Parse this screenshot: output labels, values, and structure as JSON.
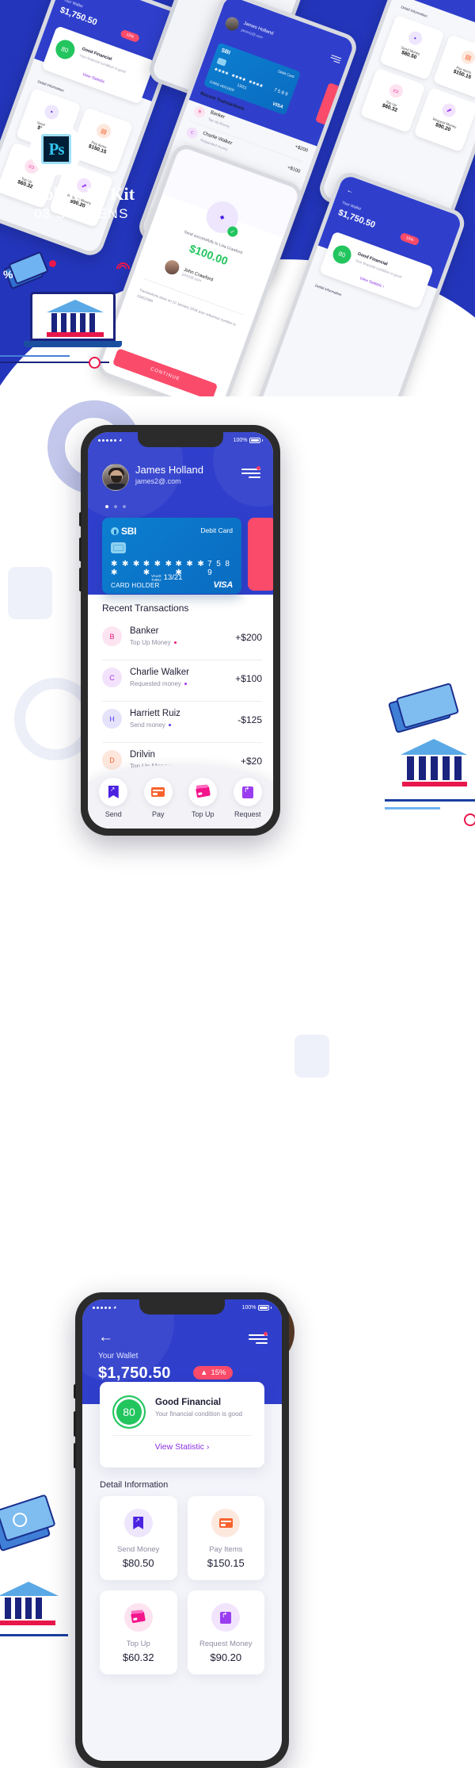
{
  "branding": {
    "badge_label": "Ps",
    "title": "Mobile UI Kit",
    "subtitle": "03 SCREENS",
    "background_color": "#2335bb",
    "accent_color": "#2f3fcc",
    "pink_accent": "#fb4b6a"
  },
  "phone_transactions": {
    "status_bar": {
      "carrier_dots": "•••••",
      "wifi": "wifi-icon",
      "battery": "100%"
    },
    "profile": {
      "name": "James Holland",
      "email": "james2@.com",
      "avatar": "user-avatar"
    },
    "card": {
      "bank": "SBI",
      "type": "Debit Card",
      "digits_masked_1": "✱ ✱ ✱ ✱",
      "digits_masked_2": "✱ ✱ ✱ ✱",
      "digits_masked_3": "✱ ✱ ✱ ✱",
      "digits_last": "7 5 8 9",
      "valid_label_1": "VALID",
      "valid_label_2": "THRU",
      "valid_thru": "13/21",
      "holder_label": "CARD HOLDER",
      "network": "VISA"
    },
    "transactions_title": "Recent Transactions",
    "transactions": [
      {
        "initial": "B",
        "name": "Banker",
        "sub": "Top Up Money",
        "amount": "+$200",
        "dot_color": "#e8197d",
        "av_bg": "#fce4f1",
        "av_fg": "#e8197d"
      },
      {
        "initial": "C",
        "name": "Charlie Walker",
        "sub": "Requested money",
        "amount": "+$100",
        "dot_color": "#a933e8",
        "av_bg": "#f3e2fb",
        "av_fg": "#a933e8"
      },
      {
        "initial": "H",
        "name": "Harriett Ruiz",
        "sub": "Send money",
        "amount": "-$125",
        "dot_color": "#5b3ce8",
        "av_bg": "#e5e2fb",
        "av_fg": "#5b3ce8"
      },
      {
        "initial": "D",
        "name": "Drilvin",
        "sub": "Top Up Money",
        "amount": "+$20",
        "dot_color": "#f7622c",
        "av_bg": "#fde7dd",
        "av_fg": "#f7622c"
      }
    ],
    "bottom_nav": [
      {
        "label": "Send",
        "icon": "send-icon"
      },
      {
        "label": "Pay",
        "icon": "pay-card-icon"
      },
      {
        "label": "Top Up",
        "icon": "topup-card-icon"
      },
      {
        "label": "Request",
        "icon": "request-icon"
      }
    ]
  },
  "phone_wallet": {
    "status_bar": {
      "carrier_dots": "•••••",
      "wifi": "wifi-icon",
      "battery": "100%"
    },
    "back_icon": "back-arrow-icon",
    "menu_icon": "hamburger-menu-icon",
    "wallet_label": "Your Wallet",
    "wallet_amount": "$1,750.50",
    "change_badge": "15%",
    "change_arrow": "▲",
    "finance": {
      "score": "80",
      "title": "Good Financial",
      "subtitle": "Your financial condition is good",
      "link": "View Statistic",
      "link_chevron": "›"
    },
    "detail_title": "Detail Information",
    "detail_cards": [
      {
        "label": "Send Money",
        "value": "$80.50",
        "icon": "send-icon",
        "bub": "#ede6fd",
        "fg": "#4b22e0"
      },
      {
        "label": "Pay Items",
        "value": "$150.15",
        "icon": "pay-card-icon",
        "bub": "#fde8de",
        "fg": "#f7622c"
      },
      {
        "label": "Top Up",
        "value": "$60.32",
        "icon": "topup-card-icon",
        "bub": "#fde2ef",
        "fg": "#f3158c"
      },
      {
        "label": "Request Money",
        "value": "$90.20",
        "icon": "request-icon",
        "bub": "#f2e4fd",
        "fg": "#9a3df0"
      }
    ]
  },
  "mini_screens": {
    "wallet_label": "Your Wallet",
    "wallet_amount": "$1,750.50",
    "badge": "15%",
    "score": "80",
    "fin_title": "Good Financial",
    "fin_sub": "Your financial condition is good",
    "fin_link": "View Statistic",
    "detail_title": "Detail Information",
    "send_money_label": "Send Money",
    "send_money_value": "$80.50",
    "pay_items_label": "Pay Items",
    "pay_items_value": "$150.15",
    "topup_label": "Top Up",
    "topup_value": "$60.32",
    "request_label": "Request Money",
    "request_value": "$90.20",
    "user_name": "James Holland",
    "user_mail": "james2@.com",
    "card_bank": "SBI",
    "card_type": "Debit Card",
    "card_digits": "7 5 8 9",
    "card_valid": "13/21",
    "card_holder": "CARD HOLDER",
    "card_network": "VISA",
    "recent_title": "Recent Transactions",
    "tx1_name": "Banker",
    "tx1_sub": "Top Up Money",
    "tx1_amt": "+$200",
    "tx2_name": "Charlie Walker",
    "tx2_sub": "Requested money",
    "tx2_amt": "+$100",
    "tx3_name": "Harriett Ruiz",
    "tx3_sub": "Send money",
    "tx3_amt": "-$125",
    "nav_send": "Send",
    "nav_pay": "Pay",
    "nav_topup": "Top Up",
    "nav_request": "Request",
    "success_text": "Send successfully to Lola Crawford",
    "success_amount": "$100.00",
    "success_name": "John Crawford",
    "success_mail": "john2@.com",
    "success_note": "Transactions done on 12 January 2018 your reference number is 034D2390",
    "success_btn": "CONTINUE"
  }
}
